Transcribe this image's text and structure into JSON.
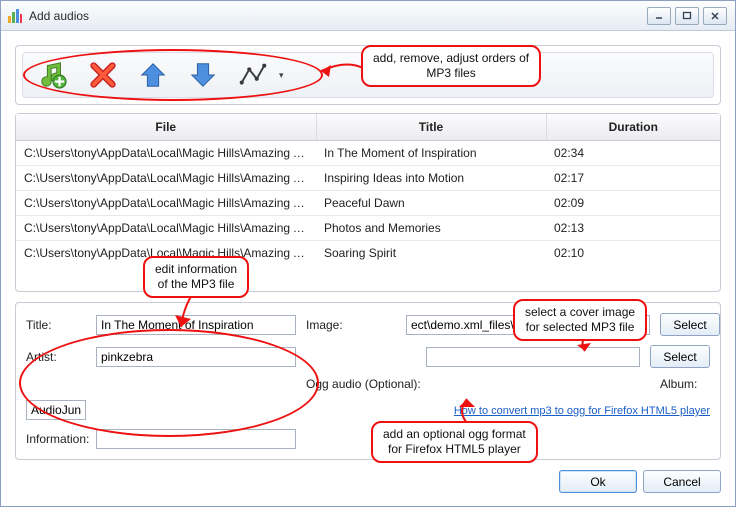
{
  "window": {
    "title": "Add audios"
  },
  "toolbar": {
    "buttons": [
      "add",
      "remove",
      "move-up",
      "move-down",
      "sort"
    ]
  },
  "table": {
    "headers": {
      "file": "File",
      "title": "Title",
      "duration": "Duration"
    },
    "rows": [
      {
        "file": "C:\\Users\\tony\\AppData\\Local\\Magic Hills\\Amazing Audi...",
        "title": "In The Moment of Inspiration",
        "duration": "02:34"
      },
      {
        "file": "C:\\Users\\tony\\AppData\\Local\\Magic Hills\\Amazing Audi...",
        "title": "Inspiring Ideas into Motion",
        "duration": "02:17"
      },
      {
        "file": "C:\\Users\\tony\\AppData\\Local\\Magic Hills\\Amazing Audi...",
        "title": "Peaceful Dawn",
        "duration": "02:09"
      },
      {
        "file": "C:\\Users\\tony\\AppData\\Local\\Magic Hills\\Amazing Audi...",
        "title": "Photos and Memories",
        "duration": "02:13"
      },
      {
        "file": "C:\\Users\\tony\\AppData\\Local\\Magic Hills\\Amazing Audi...",
        "title": "Soaring Spirit",
        "duration": "02:10"
      }
    ]
  },
  "form": {
    "labels": {
      "title": "Title:",
      "artist": "Artist:",
      "album": "Album:",
      "information": "Information:",
      "image": "Image:",
      "ogg": "Ogg audio (Optional):"
    },
    "values": {
      "title": "In The Moment of Inspiration",
      "artist": "pinkzebra",
      "album": "AudioJungle",
      "information": "",
      "image": "ect\\demo.xml_files\\golden-wheat-field.jpg",
      "ogg": ""
    },
    "select_label": "Select",
    "help_link": "How to convert mp3 to ogg for Firefox HTML5 player"
  },
  "dialog": {
    "ok": "Ok",
    "cancel": "Cancel"
  },
  "annotations": {
    "toolbar_note": "add, remove, adjust orders of\nMP3 files",
    "edit_note": "edit information\nof the MP3 file",
    "cover_note": "select a cover image\nfor selected MP3 file",
    "ogg_note": "add an optional ogg format\nfor Firefox HTML5 player"
  }
}
